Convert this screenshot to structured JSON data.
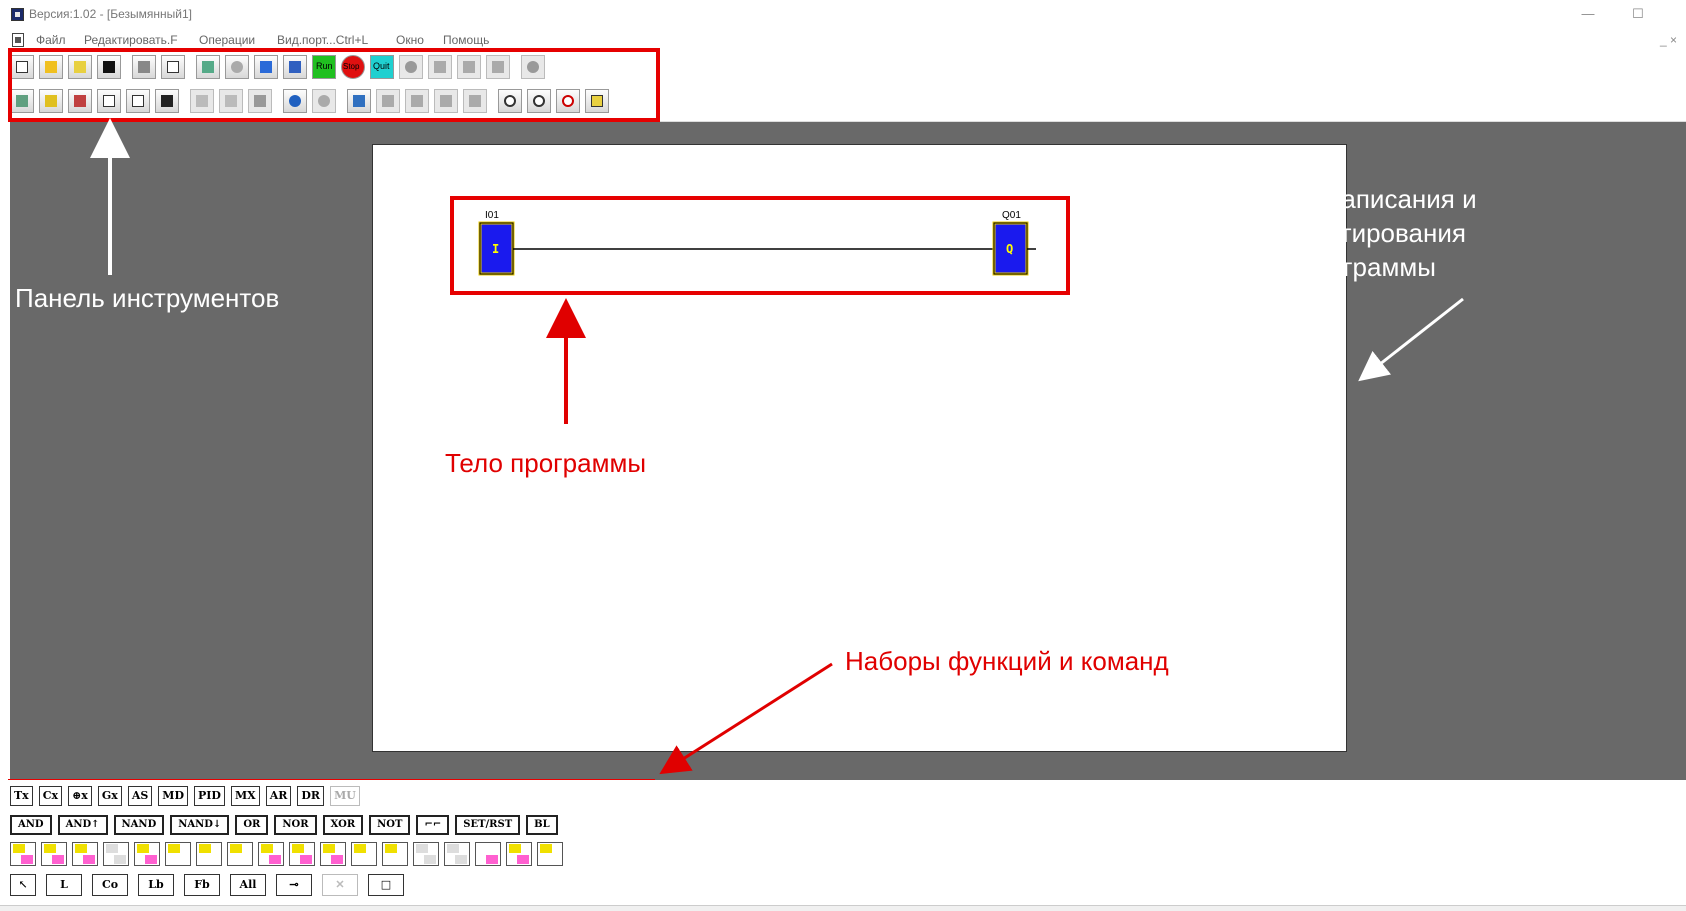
{
  "window": {
    "title": "Версия:1.02 - [Безымянный1]",
    "minimize": "—",
    "maximize": "☐"
  },
  "menu": {
    "items": [
      "Файл",
      "Редактировать.F",
      "Операции",
      "Вид.порт...Ctrl+L",
      "Окно",
      "Помощь"
    ],
    "mdi_controls": "_ ×"
  },
  "toolbar": {
    "run_label": "Run",
    "stop_label": "Stop",
    "quit_label": "Quit"
  },
  "diagram": {
    "input_label": "I01",
    "input_letter": "I",
    "output_label": "Q01",
    "output_letter": "Q"
  },
  "annotations": {
    "toolbar_panel": "Панель инструментов",
    "program_body": "Тело программы",
    "edit_window_line1": "Окно написания и",
    "edit_window_line2": "редактирования",
    "edit_window_line3": "программы",
    "function_sets": "Наборы функций и команд"
  },
  "palette": {
    "row1": [
      "Tx",
      "Cx",
      "⊕x",
      "Gx",
      "AS",
      "MD",
      "PID",
      "MX",
      "AR",
      "DR",
      "MU"
    ],
    "row2": [
      "AND",
      "AND↑",
      "NAND",
      "NAND↓",
      "OR",
      "NOR",
      "XOR",
      "NOT",
      "⌐⌐",
      "SET/RST",
      "BL"
    ],
    "row4": [
      "↖",
      "L",
      "Co",
      "Lb",
      "Fb",
      "All",
      "⊸",
      "✕",
      "□"
    ]
  },
  "colors": {
    "workspace": "#696969",
    "annotation_red": "#e00000",
    "block_fill": "#1010ee",
    "block_border": "#f0d000"
  }
}
